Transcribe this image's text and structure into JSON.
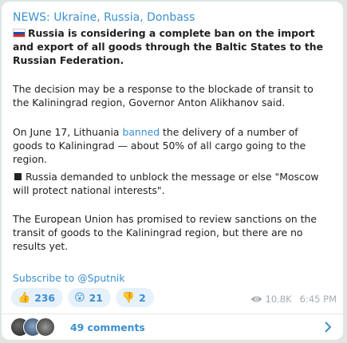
{
  "post": {
    "channel_title": "NEWS: Ukraine, Russia, Donbass",
    "headline": "Russia is considering a complete ban on the import and export of all goods through the Baltic States to the Russian Federation.",
    "paragraph1": "The decision may be a response to the blockade of transit to the Kaliningrad region, Governor Anton Alikhanov said.",
    "paragraph2_before": "On June 17, Lithuania ",
    "paragraph2_link": "banned",
    "paragraph2_after": " the delivery of a number of goods to Kaliningrad — about 50% of all cargo going to the region.",
    "paragraph3": "Russia demanded to unblock the message or else \"Moscow will protect national interests\".",
    "paragraph4": "The European Union has promised to review sanctions on the transit of goods to the Kaliningrad region, but there are no results yet.",
    "subscribe": "Subscribe to @Sputnik"
  },
  "reactions": [
    {
      "emoji": "👍",
      "icon": "thumbs-up-icon",
      "count": "236"
    },
    {
      "emoji": "😮",
      "icon": "surprised-face-icon",
      "count": "21"
    },
    {
      "emoji": "👎",
      "icon": "thumbs-down-icon",
      "count": "2"
    }
  ],
  "meta": {
    "views": "10.8K",
    "time": "6:45 PM"
  },
  "comments": {
    "label": "49 comments"
  },
  "colors": {
    "accent": "#3a8fcf",
    "text": "#1f1f1f",
    "muted": "#a2acb3",
    "reaction_bg": "#e6f1fb",
    "background": "#dfe6e3"
  }
}
